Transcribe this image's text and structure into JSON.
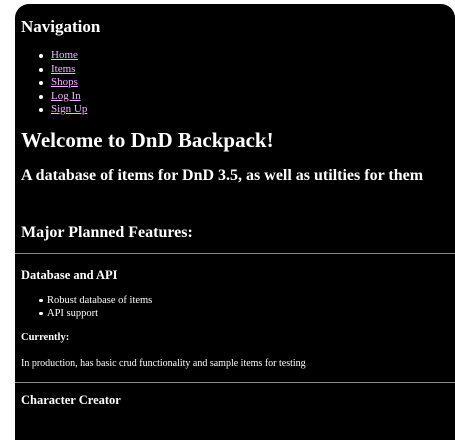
{
  "nav": {
    "title": "Navigation",
    "links": [
      "Home",
      "Items",
      "Shops",
      "Log In",
      "Sign Up"
    ],
    "link_color": "#eeb6ff"
  },
  "main": {
    "welcome": "Welcome to DnD Backpack!",
    "tagline": "A database of items for DnD 3.5, as well as utilties for them",
    "features_title": "Major Planned Features:"
  },
  "features": [
    {
      "title": "Database and API",
      "bullets": [
        "Robust database of items",
        "API support"
      ],
      "status_label": "Currently:",
      "status_text": "In production, has basic crud functionality and sample items for testing"
    },
    {
      "title": "Character Creator"
    }
  ],
  "colors": {
    "background": "#000000",
    "text": "#ffffff",
    "rule": "#8a8a8a"
  }
}
